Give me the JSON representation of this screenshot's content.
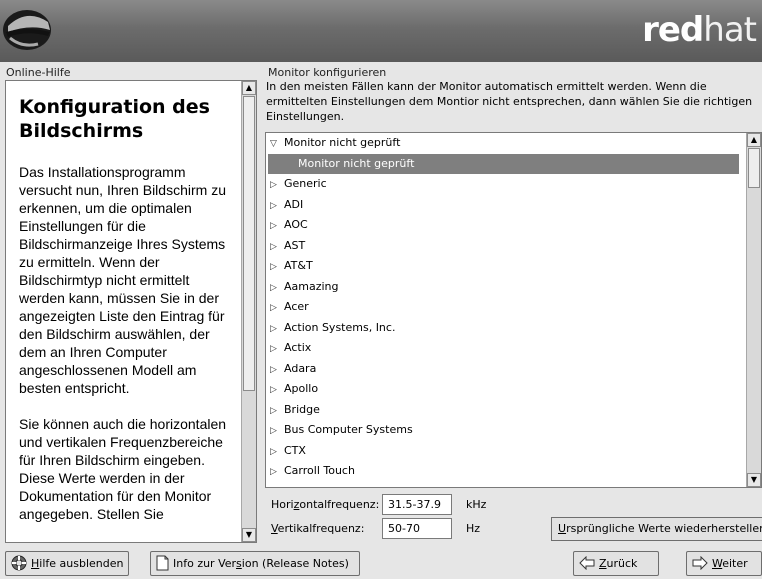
{
  "header": {
    "brand_bold": "red",
    "brand_light": "hat"
  },
  "help": {
    "section_label": "Online-Hilfe",
    "title": "Konfiguration des Bildschirms",
    "paragraphs": [
      "Das Installationsprogramm versucht nun, Ihren Bildschirm zu erkennen, um die optimalen Einstellungen für die Bildschirmanzeige Ihres Systems zu ermitteln. Wenn der Bildschirmtyp nicht ermittelt werden kann, müssen Sie in der angezeigten Liste den Eintrag für den Bildschirm auswählen, der dem an Ihren Computer angeschlossenen Modell am besten entspricht.",
      "Sie können auch die horizontalen und vertikalen Frequenzbereiche für Ihren Bildschirm eingeben. Diese Werte werden in der Dokumentation für den Monitor angegeben. Stellen Sie"
    ]
  },
  "monitor": {
    "section_label": "Monitor konfigurieren",
    "description": "In den meisten Fällen kann der Monitor automatisch ermittelt werden. Wenn die ermittelten Einstellungen dem Montior nicht entsprechen, dann wählen Sie die richtigen Einstellungen.",
    "tree": {
      "expanded_group": "Monitor nicht geprüft",
      "selected_child": "Monitor nicht geprüft",
      "groups": [
        "Generic",
        "ADI",
        "AOC",
        "AST",
        "AT&T",
        "Aamazing",
        "Acer",
        "Action Systems, Inc.",
        "Actix",
        "Adara",
        "Apollo",
        "Bridge",
        "Bus Computer Systems",
        "CTX",
        "Carroll Touch"
      ]
    },
    "hfreq": {
      "label_pre": "Hori",
      "label_ul": "z",
      "label_post": "ontalfrequenz:",
      "value": "31.5-37.9",
      "unit": "kHz"
    },
    "vfreq": {
      "label_pre": "",
      "label_ul": "V",
      "label_post": "ertikalfrequenz:",
      "value": "50-70",
      "unit": "Hz"
    },
    "restore": {
      "pre": "",
      "ul": "U",
      "post": "rsprüngliche Werte wiederherstellen"
    }
  },
  "footer": {
    "hide_help": {
      "pre": "",
      "ul": "H",
      "post": "ilfe ausblenden"
    },
    "release_notes": {
      "pre": "Info zur Ver",
      "ul": "s",
      "post": "ion (Release Notes)"
    },
    "back": {
      "pre": "",
      "ul": "Z",
      "post": "urück"
    },
    "next": {
      "pre": "",
      "ul": "W",
      "post": "eiter"
    }
  },
  "colors": {
    "banner": "#6c6c6c",
    "selection": "#7f7f7f",
    "background": "#e6e6e6"
  }
}
